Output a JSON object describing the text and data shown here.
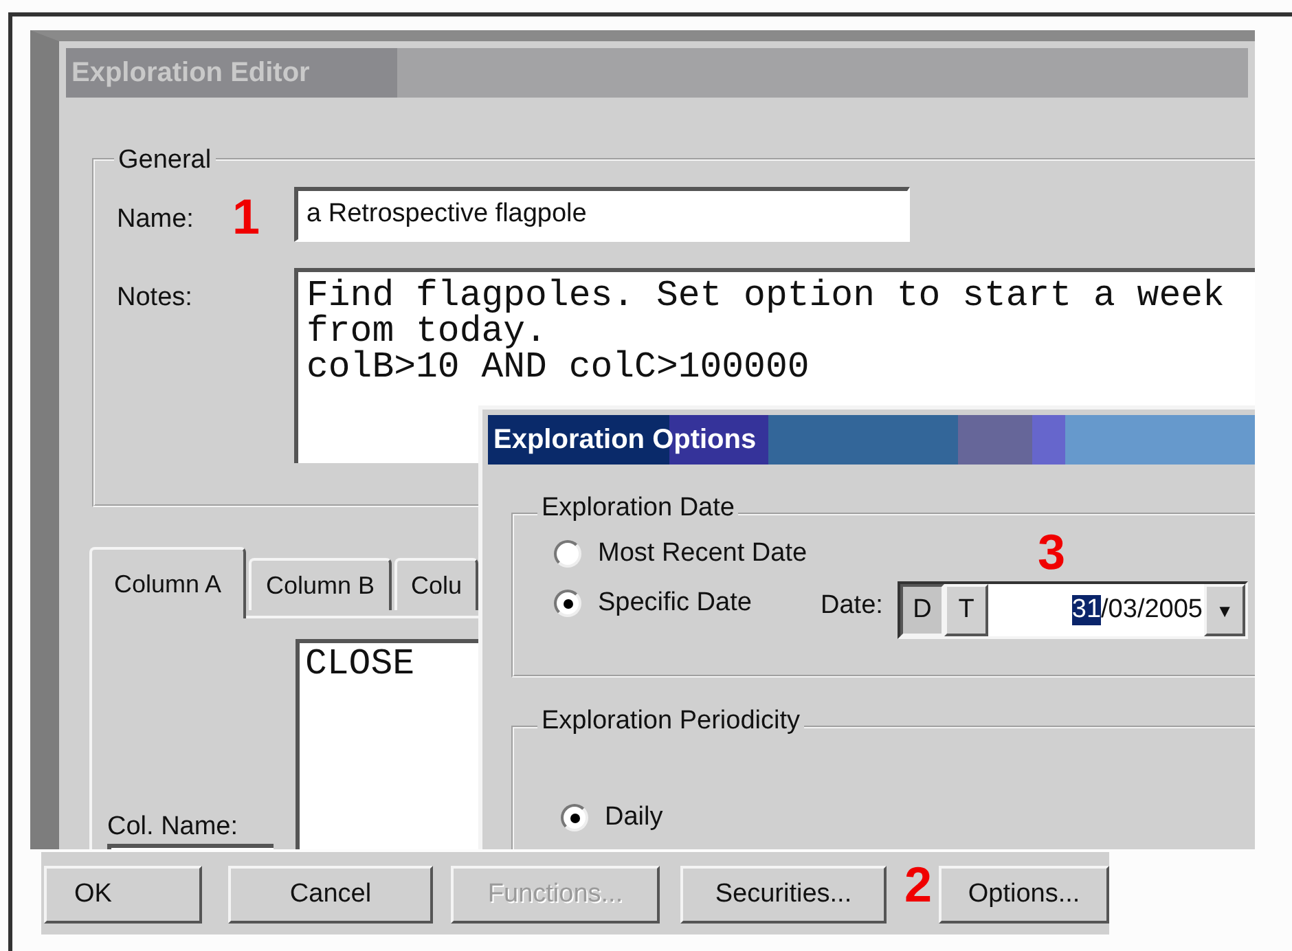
{
  "editor": {
    "title": "Exploration Editor",
    "general": {
      "label": "General",
      "name_label": "Name:",
      "name_callout": "1",
      "name_value": "a Retrospective flagpole",
      "notes_label": "Notes:",
      "notes_lines": [
        "Find flagpoles. Set option to start a week",
        "from today.",
        "colB>10 AND colC>100000"
      ]
    },
    "tabs": [
      {
        "label": "Column A",
        "selected": true
      },
      {
        "label": "Column B",
        "selected": false
      },
      {
        "label": "Colu",
        "selected": false
      }
    ],
    "column_text": "CLOSE",
    "col_name_label": "Col. Name:"
  },
  "options": {
    "title": "Exploration Options",
    "date_group": {
      "label": "Exploration Date",
      "choices": [
        {
          "label": "Most Recent Date",
          "selected": false
        },
        {
          "label": "Specific Date",
          "selected": true
        }
      ],
      "date_label": "Date:",
      "callout": "3",
      "modes": [
        {
          "label": "D",
          "selected": true
        },
        {
          "label": "T",
          "selected": false
        }
      ],
      "date_selected": "31",
      "date_rest": "/03/2005",
      "dropdown": "▼"
    },
    "periodicity_group": {
      "label": "Exploration Periodicity",
      "choices": [
        {
          "label": "Daily",
          "selected": true
        }
      ]
    }
  },
  "buttons": [
    {
      "label": "OK",
      "disabled": false
    },
    {
      "label": "Cancel",
      "disabled": false
    },
    {
      "label": "Functions...",
      "disabled": true
    },
    {
      "label": "Securities...",
      "disabled": false
    },
    {
      "label": "Options...",
      "disabled": false,
      "callout": "2"
    }
  ]
}
